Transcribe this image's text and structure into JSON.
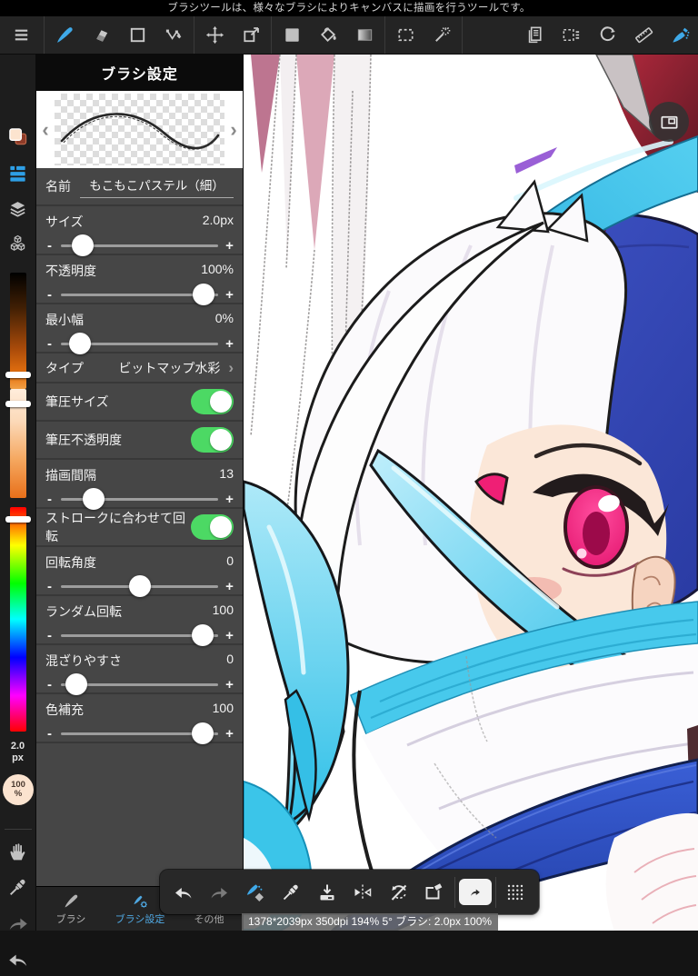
{
  "banner": {
    "text": "ブラシツールは、様々なブラシによりキャンバスに描画を行うツールです。"
  },
  "toolbar": {
    "accent": "#3fa9e8",
    "active_tool": "brush",
    "icons": [
      "menu",
      "brush",
      "eraser",
      "shape-rectangle",
      "polyline-pen",
      "move",
      "transform",
      "fill-rectangle",
      "paint-bucket",
      "gradient",
      "select",
      "magic-wand",
      "panel-pages",
      "select-menu",
      "rotate-canvas",
      "ruler",
      "airbrush"
    ]
  },
  "sidebar": {
    "icons": [
      "color-swatches",
      "brush-list",
      "layers",
      "materials",
      "hand",
      "eyedropper",
      "redo",
      "undo"
    ],
    "size_value": "2.0",
    "size_unit": "px",
    "opacity_value": "100",
    "opacity_unit": "%",
    "current_color": "#fbe3cf"
  },
  "panel": {
    "title": "ブラシ設定",
    "prev_arrow": "‹",
    "next_arrow": "›",
    "chevron": "›",
    "minus": "-",
    "plus": "+",
    "name_label": "名前",
    "name_value": "もこもこパステル（細）",
    "rows": [
      {
        "type": "slider",
        "label": "サイズ",
        "value": "2.0px",
        "percent": 14
      },
      {
        "type": "slider",
        "label": "不透明度",
        "value": "100%",
        "percent": 91
      },
      {
        "type": "slider",
        "label": "最小幅",
        "value": "0%",
        "percent": 12
      },
      {
        "type": "select",
        "label": "タイプ",
        "value": "ビットマップ水彩"
      },
      {
        "type": "toggle",
        "label": "筆圧サイズ",
        "on": true
      },
      {
        "type": "toggle",
        "label": "筆圧不透明度",
        "on": true
      },
      {
        "type": "slider",
        "label": "描画間隔",
        "value": "13",
        "percent": 21
      },
      {
        "type": "toggle",
        "label": "ストロークに合わせて回転",
        "on": true
      },
      {
        "type": "slider",
        "label": "回転角度",
        "value": "0",
        "percent": 50
      },
      {
        "type": "slider",
        "label": "ランダム回転",
        "value": "100",
        "percent": 90
      },
      {
        "type": "slider",
        "label": "混ざりやすさ",
        "value": "0",
        "percent": 10
      },
      {
        "type": "slider",
        "label": "色補充",
        "value": "100",
        "percent": 90
      }
    ]
  },
  "tabs": [
    {
      "label": "ブラシ",
      "active": false
    },
    {
      "label": "ブラシ設定",
      "active": true
    },
    {
      "label": "その他",
      "active": false
    }
  ],
  "float_toolbar": {
    "icons": [
      "undo",
      "redo",
      "brush-eraser-toggle",
      "eyedropper",
      "save",
      "flip-horizontal",
      "reset-rotation",
      "clear",
      "quick-arrow",
      "drag-handle"
    ]
  },
  "navigator": {
    "icon": "window"
  },
  "status": {
    "text": "1378*2039px 350dpi 194% 5° ブラシ: 2.0px 100%"
  },
  "artwork": {
    "colors": {
      "hood_cyan": "#35c1e8",
      "hood_blue": "#3a50c2",
      "hair_white": "#fbfafc",
      "hair_cyan": "#3ac4e9",
      "eye_magenta": "#ee1d72",
      "skin": "#fbe7d8",
      "corner_maroon": "#8e2436",
      "scarf_cyan": "#47c9ec",
      "sash_blue": "#3050c6"
    }
  }
}
